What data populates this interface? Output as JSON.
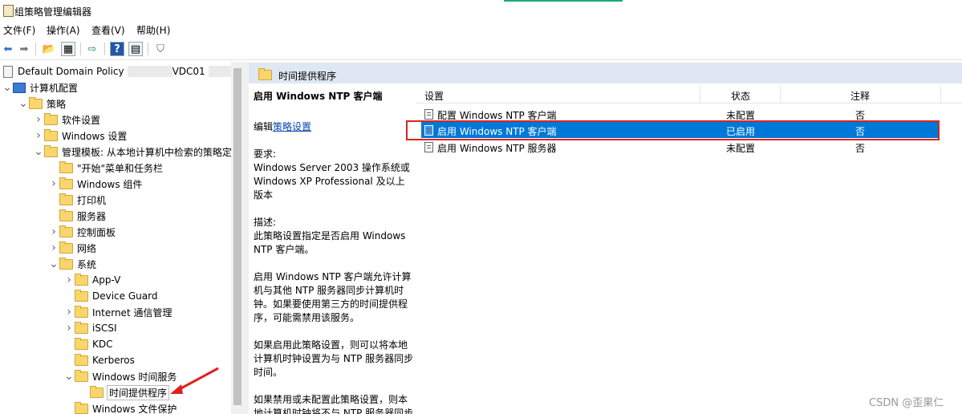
{
  "window": {
    "title": "组策略管理编辑器"
  },
  "menu": [
    "文件(F)",
    "操作(A)",
    "查看(V)",
    "帮助(H)"
  ],
  "tree": {
    "root": {
      "label": "Default Domain Policy",
      "suffix": "VDC01",
      "trail": "C"
    },
    "items": [
      {
        "label": "计算机配置",
        "chev": "v"
      },
      {
        "label": "策略",
        "chev": "v"
      },
      {
        "label": "软件设置",
        "chev": ">"
      },
      {
        "label": "Windows 设置",
        "chev": ">"
      },
      {
        "label": "管理模板: 从本地计算机中检索的策略定",
        "chev": "v"
      },
      {
        "label": "\"开始\"菜单和任务栏",
        "chev": ""
      },
      {
        "label": "Windows 组件",
        "chev": ">"
      },
      {
        "label": "打印机",
        "chev": ""
      },
      {
        "label": "服务器",
        "chev": ""
      },
      {
        "label": "控制面板",
        "chev": ">"
      },
      {
        "label": "网络",
        "chev": ">"
      },
      {
        "label": "系统",
        "chev": "v"
      },
      {
        "label": "App-V",
        "chev": ">"
      },
      {
        "label": "Device Guard",
        "chev": ""
      },
      {
        "label": "Internet 通信管理",
        "chev": ">"
      },
      {
        "label": "iSCSI",
        "chev": ">"
      },
      {
        "label": "KDC",
        "chev": ""
      },
      {
        "label": "Kerberos",
        "chev": ""
      },
      {
        "label": "Windows 时间服务",
        "chev": "v"
      },
      {
        "label": "时间提供程序",
        "chev": ""
      },
      {
        "label": "Windows 文件保护",
        "chev": ""
      }
    ]
  },
  "details": {
    "header": "时间提供程序",
    "policy_title": "启用 Windows NTP 客户端",
    "edit_prefix": "编辑",
    "edit_link": "策略设置",
    "req_label": "要求:",
    "req_text": "Windows Server 2003 操作系统或 Windows XP Professional 及以上版本",
    "desc_label": "描述:",
    "desc_1": "此策略设置指定是否启用 Windows NTP 客户端。",
    "desc_2": "启用 Windows NTP 客户端允许计算机与其他 NTP 服务器同步计算机时钟。如果要使用第三方的时间提供程序，可能需禁用该服务。",
    "desc_3": "如果启用此策略设置，则可以将本地计算机时钟设置为与 NTP 服务器同步时间。",
    "desc_4": "如果禁用或未配置此策略设置，则本地计算机时钟将不与 NTP 服务器同步"
  },
  "list": {
    "columns": [
      "设置",
      "状态",
      "注释"
    ],
    "rows": [
      {
        "setting": "配置 Windows NTP 客户端",
        "state": "未配置",
        "comment": "否"
      },
      {
        "setting": "启用 Windows NTP 客户端",
        "state": "已启用",
        "comment": "否"
      },
      {
        "setting": "启用 Windows NTP 服务器",
        "state": "未配置",
        "comment": "否"
      }
    ]
  },
  "watermark": "CSDN @歪果仁",
  "colors": {
    "selection": "#0078d7",
    "highlight_box": "#d9251d",
    "header_bg": "#dfe7f2"
  }
}
